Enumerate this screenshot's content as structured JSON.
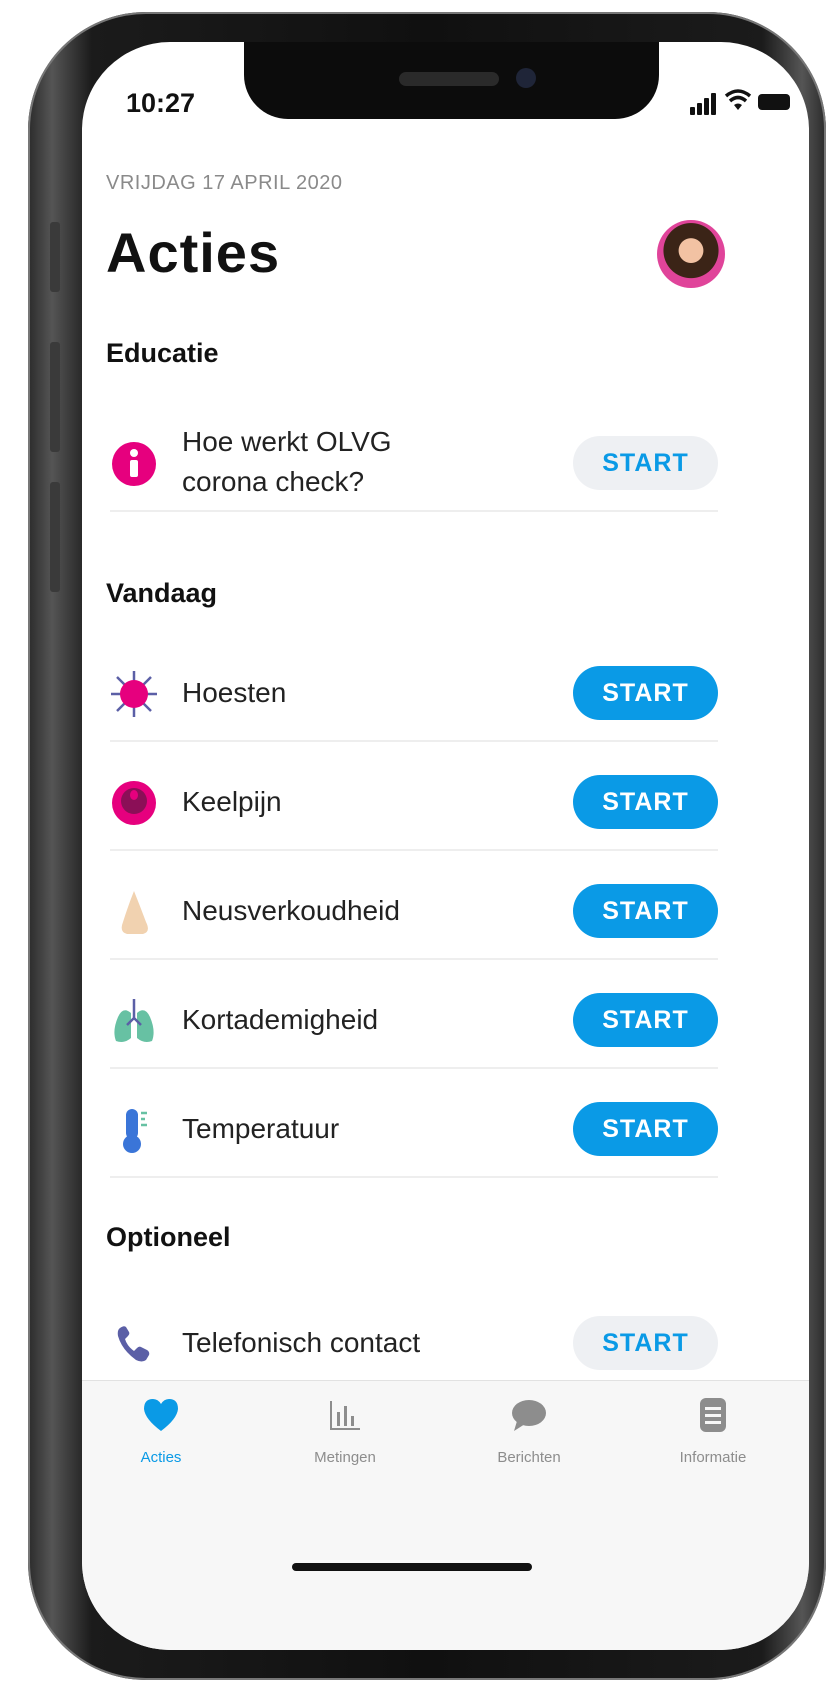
{
  "status_bar": {
    "time": "10:27"
  },
  "header": {
    "date": "VRIJDAG 17 APRIL 2020",
    "title": "Acties"
  },
  "sections": {
    "educatie": {
      "title": "Educatie",
      "items": [
        {
          "label_line1": "Hoe werkt OLVG",
          "label_line2": "corona check?",
          "button": "START",
          "icon": "info-icon"
        }
      ]
    },
    "vandaag": {
      "title": "Vandaag",
      "items": [
        {
          "label": "Hoesten",
          "button": "START",
          "icon": "virus-icon"
        },
        {
          "label": "Keelpijn",
          "button": "START",
          "icon": "throat-icon"
        },
        {
          "label": "Neusverkoudheid",
          "button": "START",
          "icon": "nose-icon"
        },
        {
          "label": "Kortademigheid",
          "button": "START",
          "icon": "lungs-icon"
        },
        {
          "label": "Temperatuur",
          "button": "START",
          "icon": "thermometer-icon"
        }
      ]
    },
    "optioneel": {
      "title": "Optioneel",
      "items": [
        {
          "label": "Telefonisch contact",
          "button": "START",
          "icon": "phone-icon"
        }
      ]
    }
  },
  "tabs": [
    {
      "label": "Acties",
      "icon": "heart-icon",
      "active": true
    },
    {
      "label": "Metingen",
      "icon": "bar-chart-icon",
      "active": false
    },
    {
      "label": "Berichten",
      "icon": "chat-bubble-icon",
      "active": false
    },
    {
      "label": "Informatie",
      "icon": "document-icon",
      "active": false
    }
  ],
  "colors": {
    "accent": "#0a9ae6",
    "secondary_button_bg": "#eef0f3",
    "magenta_icon": "#e6007e",
    "tab_inactive": "#8d8d8d"
  }
}
